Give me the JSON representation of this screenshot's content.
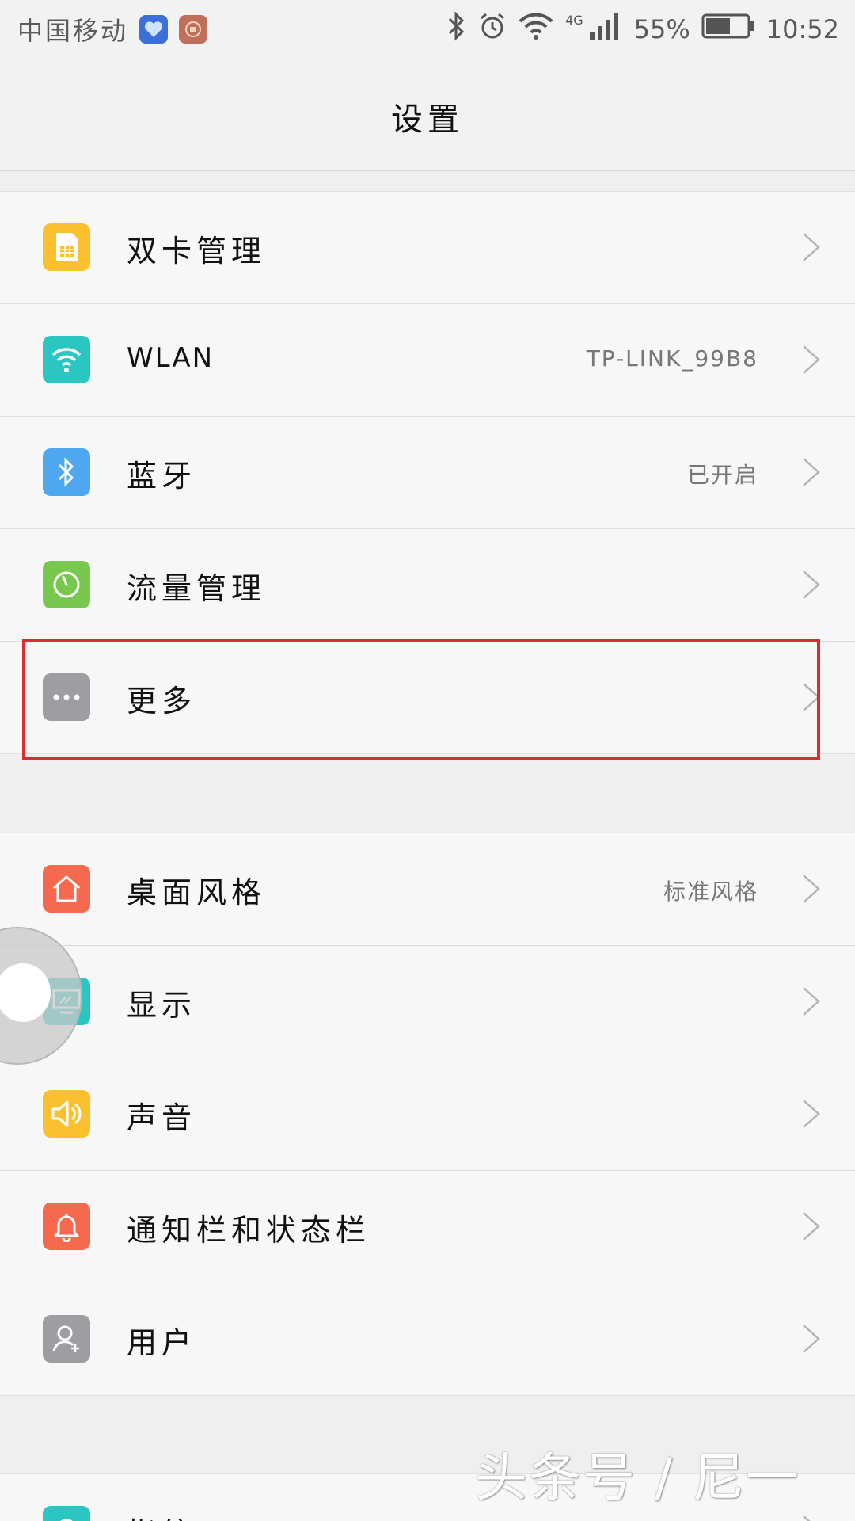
{
  "statusbar": {
    "carrier": "中国移动",
    "network_type": "4G",
    "battery": "55%",
    "time": "10:52"
  },
  "header": {
    "title": "设置"
  },
  "group1": {
    "items": [
      {
        "label": "双卡管理",
        "value": "",
        "icon": "sim-card-icon",
        "color": "#fbc02d"
      },
      {
        "label": "WLAN",
        "value": "TP-LINK_99B8",
        "icon": "wifi-icon",
        "color": "#2cc6c2"
      },
      {
        "label": "蓝牙",
        "value": "已开启",
        "icon": "bluetooth-icon",
        "color": "#4ea7ef"
      },
      {
        "label": "流量管理",
        "value": "",
        "icon": "data-usage-icon",
        "color": "#78c850"
      },
      {
        "label": "更多",
        "value": "",
        "icon": "more-icon",
        "color": "#9d9da2"
      }
    ]
  },
  "group2": {
    "items": [
      {
        "label": "桌面风格",
        "value": "标准风格",
        "icon": "home-icon",
        "color": "#f56a4f"
      },
      {
        "label": "显示",
        "value": "",
        "icon": "display-icon",
        "color": "#2cc6c2"
      },
      {
        "label": "声音",
        "value": "",
        "icon": "speaker-icon",
        "color": "#fbc02d"
      },
      {
        "label": "通知栏和状态栏",
        "value": "",
        "icon": "bell-icon",
        "color": "#f56a4f"
      },
      {
        "label": "用户",
        "value": "",
        "icon": "user-icon",
        "color": "#9d9da2"
      }
    ]
  },
  "group3": {
    "items": [
      {
        "label": "指纹",
        "value": "",
        "icon": "fingerprint-icon",
        "color": "#2cc6c2"
      }
    ]
  },
  "watermark": "头条号 / 尼一",
  "highlight_color": "#e02a2f"
}
